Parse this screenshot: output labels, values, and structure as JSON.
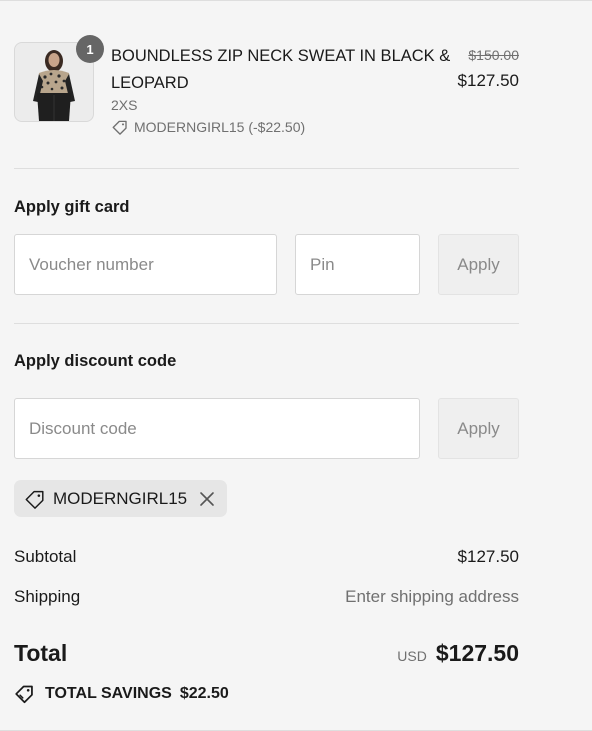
{
  "product": {
    "quantity": "1",
    "name": "BOUNDLESS ZIP NECK SWEAT IN BLACK & LEOPARD",
    "variant": "2XS",
    "discount": "MODERNGIRL15 (-$22.50)",
    "original_price": "$150.00",
    "price": "$127.50",
    "thumbnail_icon": "product-photo-icon"
  },
  "gift_card": {
    "title": "Apply gift card",
    "voucher_placeholder": "Voucher number",
    "voucher_value": "",
    "pin_placeholder": "Pin",
    "pin_value": "",
    "apply_label": "Apply"
  },
  "discount": {
    "title": "Apply discount code",
    "code_placeholder": "Discount code",
    "code_value": "",
    "apply_label": "Apply",
    "applied_code": "MODERNGIRL15"
  },
  "totals": {
    "subtotal_label": "Subtotal",
    "subtotal_value": "$127.50",
    "shipping_label": "Shipping",
    "shipping_value": "Enter shipping address",
    "total_label": "Total",
    "currency": "USD",
    "total_value": "$127.50",
    "savings_label": "TOTAL SAVINGS",
    "savings_value": "$22.50"
  },
  "colors": {
    "background": "#f5f5f5",
    "text": "#1a1a1a",
    "muted_text": "#707070",
    "badge": "#666666",
    "divider": "#dedede",
    "button_bg": "#efefef",
    "chip_bg": "#e6e6e6"
  }
}
